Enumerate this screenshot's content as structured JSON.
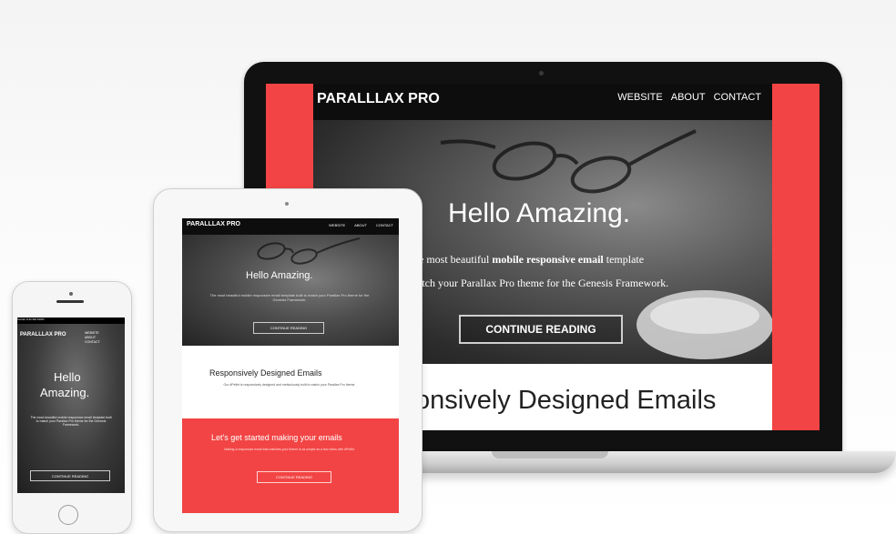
{
  "laptop": {
    "brand": "PARALLLAX PRO",
    "nav": [
      "WEBSITE",
      "ABOUT",
      "CONTACT"
    ],
    "hero_title": "Hello Amazing.",
    "hero_line1_pre": "he most beautiful ",
    "hero_line1_bold": "mobile responsive email",
    "hero_line1_post": " template",
    "hero_line2": "atch your Parallax Pro theme for the Genesis Framework.",
    "button": "CONTINUE READING",
    "section_title": "onsively Designed Emails"
  },
  "tablet": {
    "brand": "PARALLLAX PRO",
    "nav": [
      "WEBSITE",
      "ABOUT",
      "CONTACT"
    ],
    "hero_title": "Hello Amazing.",
    "hero_sub": "The most beautiful mobile responsive email template built to match your Parallax Pro theme for the Genesis Framework.",
    "button": "CONTINUE READING",
    "section_title": "Responsively Designed Emails",
    "section_sub": "Our #Pellet is responsively designed and meticulously built to match your Parallax Pro theme.",
    "red_title": "Let's get started making your emails",
    "red_sub": "Making a responsive email that matches your theme is as simple as a few clicks with #Pellet.",
    "red_button": "CONTINUE READING"
  },
  "phone": {
    "status": "Carrier  9:41 AM  100%",
    "brand": "PARALLLAX PRO",
    "nav": [
      "WEBSITE",
      "ABOUT",
      "CONTACT"
    ],
    "hero_title_line1": "Hello",
    "hero_title_line2": "Amazing.",
    "hero_sub": "The most beautiful mobile responsive email template built to match your Parallax Pro theme for the Genesis Framework.",
    "button": "CONTINUE READING"
  },
  "colors": {
    "accent_red": "#f24444",
    "dark": "#0d0d0d"
  }
}
